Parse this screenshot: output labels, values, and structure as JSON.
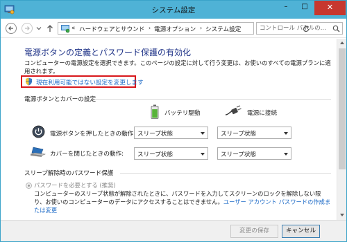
{
  "window": {
    "title": "システム設定"
  },
  "caption_buttons": {
    "minimize": "–",
    "maximize": "□",
    "close": "✕"
  },
  "nav": {
    "breadcrumbs": [
      "ハードウェアとサウンド",
      "電源オプション",
      "システム設定"
    ],
    "overflow": "«",
    "separator": "›",
    "search_placeholder": "コントロール パネルの..."
  },
  "main": {
    "heading": "電源ボタンの定義とパスワード保護の有効化",
    "description": "コンピューターの電源設定を選択できます。このページの設定に対して行う変更は、お使いのすべての電源プランに適用されます。",
    "change_settings_link": "現在利用可能ではない設定を変更します"
  },
  "power_section": {
    "title": "電源ボタンとカバーの設定",
    "columns": [
      "バッテリ駆動",
      "電源に接続"
    ],
    "rows": [
      {
        "label": "電源ボタンを押したときの動作:",
        "battery": "スリープ状態",
        "plugged": "スリープ状態"
      },
      {
        "label": "カバーを閉じたときの動作:",
        "battery": "スリープ状態",
        "plugged": "スリープ状態"
      }
    ]
  },
  "password_section": {
    "title": "スリープ解除時のパスワード保護",
    "option_label": "パスワードを必要とする (推奨)",
    "option_desc": "コンピューターのスリープ状態が解除されたときに、パスワードを入力してスクリーンのロックを解除しない限り、お使いのコンピューターのデータにアクセスすることはできません。",
    "option_link": "ユーザー アカウント パスワードの作成または変更"
  },
  "footer": {
    "save": "変更の保存",
    "cancel": "キャンセル"
  },
  "colors": {
    "titlebar": "#4fb2d6",
    "close": "#c7372f",
    "heading": "#1e3287",
    "link": "#1e6bc7",
    "highlight": "#d8161b"
  }
}
